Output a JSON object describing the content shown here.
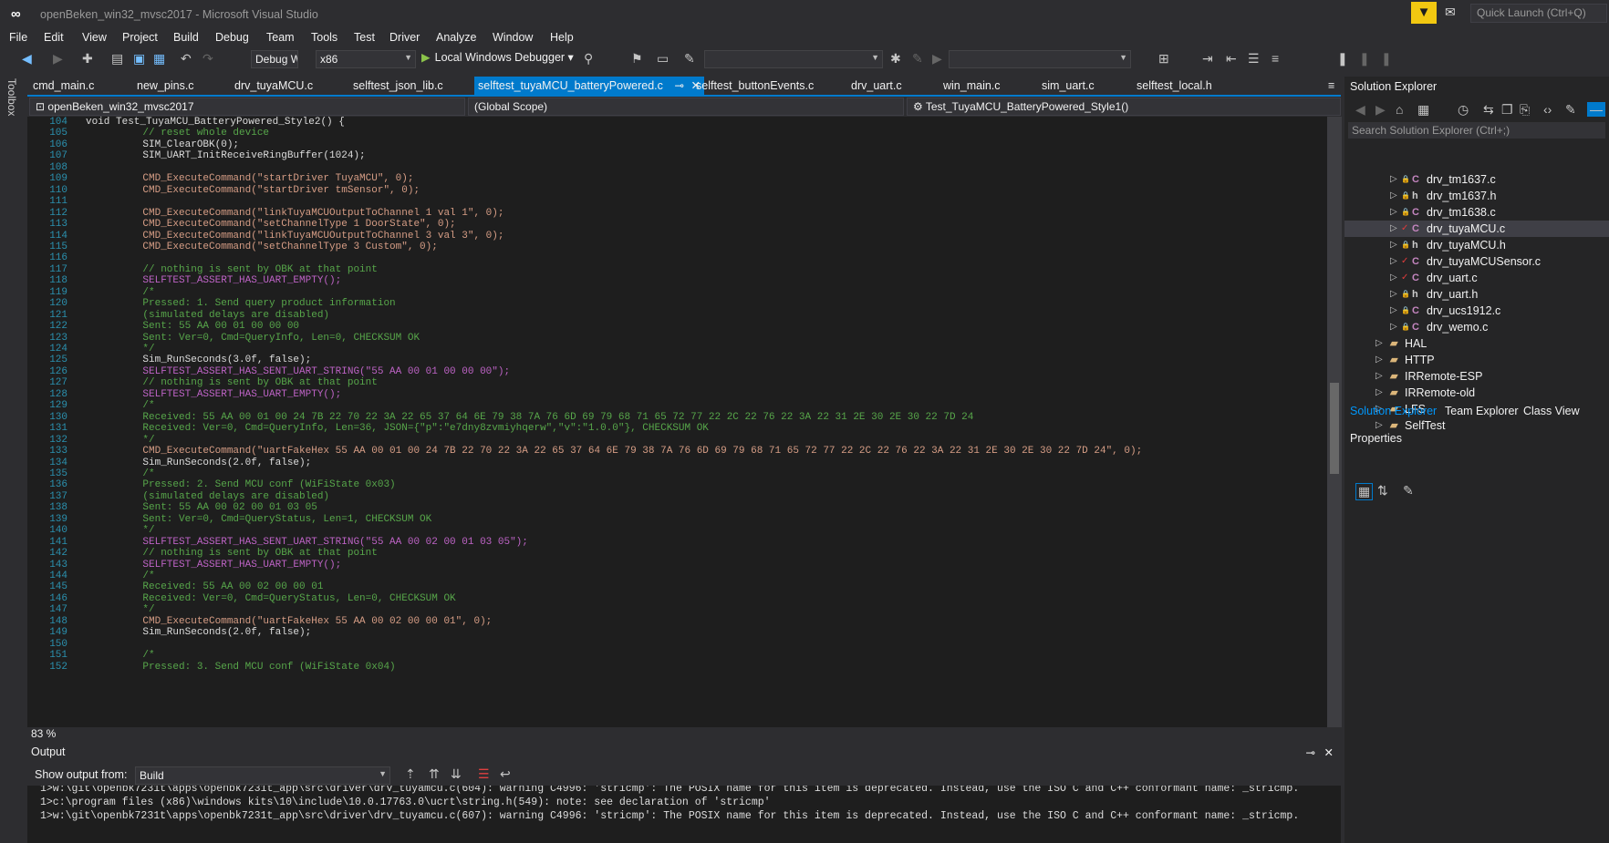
{
  "window": {
    "title": "openBeken_win32_mvsc2017 - Microsoft Visual Studio",
    "quick_launch_placeholder": "Quick Launch (Ctrl+Q)"
  },
  "menu": [
    "File",
    "Edit",
    "View",
    "Project",
    "Build",
    "Debug",
    "Team",
    "Tools",
    "Test",
    "Driver",
    "Analyze",
    "Window",
    "Help"
  ],
  "toolbar": {
    "config": "Debug W",
    "platform": "x86",
    "run_label": "Local Windows Debugger"
  },
  "toolbox_label": "Toolbox",
  "tabs": [
    {
      "label": "cmd_main.c"
    },
    {
      "label": "new_pins.c"
    },
    {
      "label": "drv_tuyaMCU.c"
    },
    {
      "label": "selftest_json_lib.c"
    },
    {
      "label": "selftest_tuyaMCU_batteryPowered.c"
    },
    {
      "label": "selftest_buttonEvents.c"
    },
    {
      "label": "drv_uart.c"
    },
    {
      "label": "win_main.c"
    },
    {
      "label": "sim_uart.c"
    },
    {
      "label": "selftest_local.h"
    }
  ],
  "navbar": {
    "project": "openBeken_win32_mvsc2017",
    "scope": "(Global Scope)",
    "function": "Test_TuyaMCU_BatteryPowered_Style1()"
  },
  "code_lines": [
    {
      "n": "104",
      "t": "void Test_TuyaMCU_BatteryPowered_Style2() {",
      "k": "plain"
    },
    {
      "n": "105",
      "t": "    // reset whole device",
      "k": "comment"
    },
    {
      "n": "106",
      "t": "    SIM_ClearOBK(0);",
      "k": "plain"
    },
    {
      "n": "107",
      "t": "    SIM_UART_InitReceiveRingBuffer(1024);",
      "k": "plain"
    },
    {
      "n": "108",
      "t": "",
      "k": "plain"
    },
    {
      "n": "109",
      "t": "    CMD_ExecuteCommand(\"startDriver TuyaMCU\", 0);",
      "k": "str"
    },
    {
      "n": "110",
      "t": "    CMD_ExecuteCommand(\"startDriver tmSensor\", 0);",
      "k": "str"
    },
    {
      "n": "111",
      "t": "",
      "k": "plain"
    },
    {
      "n": "112",
      "t": "    CMD_ExecuteCommand(\"linkTuyaMCUOutputToChannel 1 val 1\", 0);",
      "k": "str"
    },
    {
      "n": "113",
      "t": "    CMD_ExecuteCommand(\"setChannelType 1 DoorState\", 0);",
      "k": "str"
    },
    {
      "n": "114",
      "t": "    CMD_ExecuteCommand(\"linkTuyaMCUOutputToChannel 3 val 3\", 0);",
      "k": "str"
    },
    {
      "n": "115",
      "t": "    CMD_ExecuteCommand(\"setChannelType 3 Custom\", 0);",
      "k": "str"
    },
    {
      "n": "116",
      "t": "",
      "k": "plain"
    },
    {
      "n": "117",
      "t": "    // nothing is sent by OBK at that point",
      "k": "comment"
    },
    {
      "n": "118",
      "t": "    SELFTEST_ASSERT_HAS_UART_EMPTY();",
      "k": "macro"
    },
    {
      "n": "119",
      "t": "    /*",
      "k": "comment"
    },
    {
      "n": "120",
      "t": "    Pressed: 1. Send query product information",
      "k": "comment"
    },
    {
      "n": "121",
      "t": "    (simulated delays are disabled)",
      "k": "comment"
    },
    {
      "n": "122",
      "t": "    Sent: 55 AA 00 01 00 00 00",
      "k": "comment"
    },
    {
      "n": "123",
      "t": "    Sent: Ver=0, Cmd=QueryInfo, Len=0, CHECKSUM OK",
      "k": "comment"
    },
    {
      "n": "124",
      "t": "    */",
      "k": "comment"
    },
    {
      "n": "125",
      "t": "    Sim_RunSeconds(3.0f, false);",
      "k": "plain"
    },
    {
      "n": "126",
      "t": "    SELFTEST_ASSERT_HAS_SENT_UART_STRING(\"55 AA 00 01 00 00 00\");",
      "k": "macro"
    },
    {
      "n": "127",
      "t": "    // nothing is sent by OBK at that point",
      "k": "comment"
    },
    {
      "n": "128",
      "t": "    SELFTEST_ASSERT_HAS_UART_EMPTY();",
      "k": "macro"
    },
    {
      "n": "129",
      "t": "    /*",
      "k": "comment"
    },
    {
      "n": "130",
      "t": "    Received: 55 AA 00 01 00 24 7B 22 70 22 3A 22 65 37 64 6E 79 38 7A 76 6D 69 79 68 71 65 72 77 22 2C 22 76 22 3A 22 31 2E 30 2E 30 22 7D 24",
      "k": "comment"
    },
    {
      "n": "131",
      "t": "    Received: Ver=0, Cmd=QueryInfo, Len=36, JSON={\"p\":\"e7dny8zvmiyhqerw\",\"v\":\"1.0.0\"}, CHECKSUM OK",
      "k": "comment"
    },
    {
      "n": "132",
      "t": "    */",
      "k": "comment"
    },
    {
      "n": "133",
      "t": "    CMD_ExecuteCommand(\"uartFakeHex 55 AA 00 01 00 24 7B 22 70 22 3A 22 65 37 64 6E 79 38 7A 76 6D 69 79 68 71 65 72 77 22 2C 22 76 22 3A 22 31 2E 30 2E 30 22 7D 24\", 0);",
      "k": "str"
    },
    {
      "n": "134",
      "t": "    Sim_RunSeconds(2.0f, false);",
      "k": "plain"
    },
    {
      "n": "135",
      "t": "    /*",
      "k": "comment"
    },
    {
      "n": "136",
      "t": "    Pressed: 2. Send MCU conf (WiFiState 0x03)",
      "k": "comment"
    },
    {
      "n": "137",
      "t": "    (simulated delays are disabled)",
      "k": "comment"
    },
    {
      "n": "138",
      "t": "    Sent: 55 AA 00 02 00 01 03 05",
      "k": "comment"
    },
    {
      "n": "139",
      "t": "    Sent: Ver=0, Cmd=QueryStatus, Len=1, CHECKSUM OK",
      "k": "comment"
    },
    {
      "n": "140",
      "t": "    */",
      "k": "comment"
    },
    {
      "n": "141",
      "t": "    SELFTEST_ASSERT_HAS_SENT_UART_STRING(\"55 AA 00 02 00 01 03 05\");",
      "k": "macro"
    },
    {
      "n": "142",
      "t": "    // nothing is sent by OBK at that point",
      "k": "comment"
    },
    {
      "n": "143",
      "t": "    SELFTEST_ASSERT_HAS_UART_EMPTY();",
      "k": "macro"
    },
    {
      "n": "144",
      "t": "    /*",
      "k": "comment"
    },
    {
      "n": "145",
      "t": "    Received: 55 AA 00 02 00 00 01",
      "k": "comment"
    },
    {
      "n": "146",
      "t": "    Received: Ver=0, Cmd=QueryStatus, Len=0, CHECKSUM OK",
      "k": "comment"
    },
    {
      "n": "147",
      "t": "    */",
      "k": "comment"
    },
    {
      "n": "148",
      "t": "    CMD_ExecuteCommand(\"uartFakeHex 55 AA 00 02 00 00 01\", 0);",
      "k": "str"
    },
    {
      "n": "149",
      "t": "    Sim_RunSeconds(2.0f, false);",
      "k": "plain"
    },
    {
      "n": "150",
      "t": "",
      "k": "plain"
    },
    {
      "n": "151",
      "t": "    /*",
      "k": "comment"
    },
    {
      "n": "152",
      "t": "    Pressed: 3. Send MCU conf (WiFiState 0x04)",
      "k": "comment"
    }
  ],
  "zoom": "83 %",
  "output": {
    "title": "Output",
    "show_from_label": "Show output from:",
    "source": "Build",
    "lines": [
      "1>w:\\git\\openbk7231t\\apps\\openbk7231t_app\\src\\driver\\drv_tuyamcu.c(604): warning C4996: 'stricmp': The POSIX name for this item is deprecated. Instead, use the ISO C and C++ conformant name: _stricmp.",
      "1>c:\\program files (x86)\\windows kits\\10\\include\\10.0.17763.0\\ucrt\\string.h(549): note: see declaration of 'stricmp'",
      "1>w:\\git\\openbk7231t\\apps\\openbk7231t_app\\src\\driver\\drv_tuyamcu.c(607): warning C4996: 'stricmp': The POSIX name for this item is deprecated. Instead, use the ISO C and C++ conformant name: _stricmp."
    ]
  },
  "solution_explorer": {
    "title": "Solution Explorer",
    "search_placeholder": "Search Solution Explorer (Ctrl+;)",
    "items": [
      {
        "name": "drv_tm1637.c",
        "type": "c",
        "badge": "lock"
      },
      {
        "name": "drv_tm1637.h",
        "type": "h",
        "badge": "lock"
      },
      {
        "name": "drv_tm1638.c",
        "type": "c",
        "badge": "lock"
      },
      {
        "name": "drv_tuyaMCU.c",
        "type": "c",
        "badge": "check",
        "selected": true
      },
      {
        "name": "drv_tuyaMCU.h",
        "type": "h",
        "badge": "lock"
      },
      {
        "name": "drv_tuyaMCUSensor.c",
        "type": "c",
        "badge": "check"
      },
      {
        "name": "drv_uart.c",
        "type": "c",
        "badge": "check"
      },
      {
        "name": "drv_uart.h",
        "type": "h",
        "badge": "lock"
      },
      {
        "name": "drv_ucs1912.c",
        "type": "c",
        "badge": "lock"
      },
      {
        "name": "drv_wemo.c",
        "type": "c",
        "badge": "lock"
      },
      {
        "name": "HAL",
        "type": "folder"
      },
      {
        "name": "HTTP",
        "type": "folder"
      },
      {
        "name": "IRRemote-ESP",
        "type": "folder"
      },
      {
        "name": "IRRemote-old",
        "type": "folder"
      },
      {
        "name": "LFS",
        "type": "folder"
      },
      {
        "name": "SelfTest",
        "type": "folder"
      }
    ],
    "tabs": [
      "Solution Explorer",
      "Team Explorer",
      "Class View"
    ]
  },
  "properties": {
    "title": "Properties"
  },
  "colors": {
    "accent": "#007acc",
    "bg": "#2d2d30",
    "editor_bg": "#1e1e1e",
    "comment": "#57a64a",
    "macro": "#bd63c5",
    "string": "#d69d85",
    "line_number": "#2b91af"
  }
}
